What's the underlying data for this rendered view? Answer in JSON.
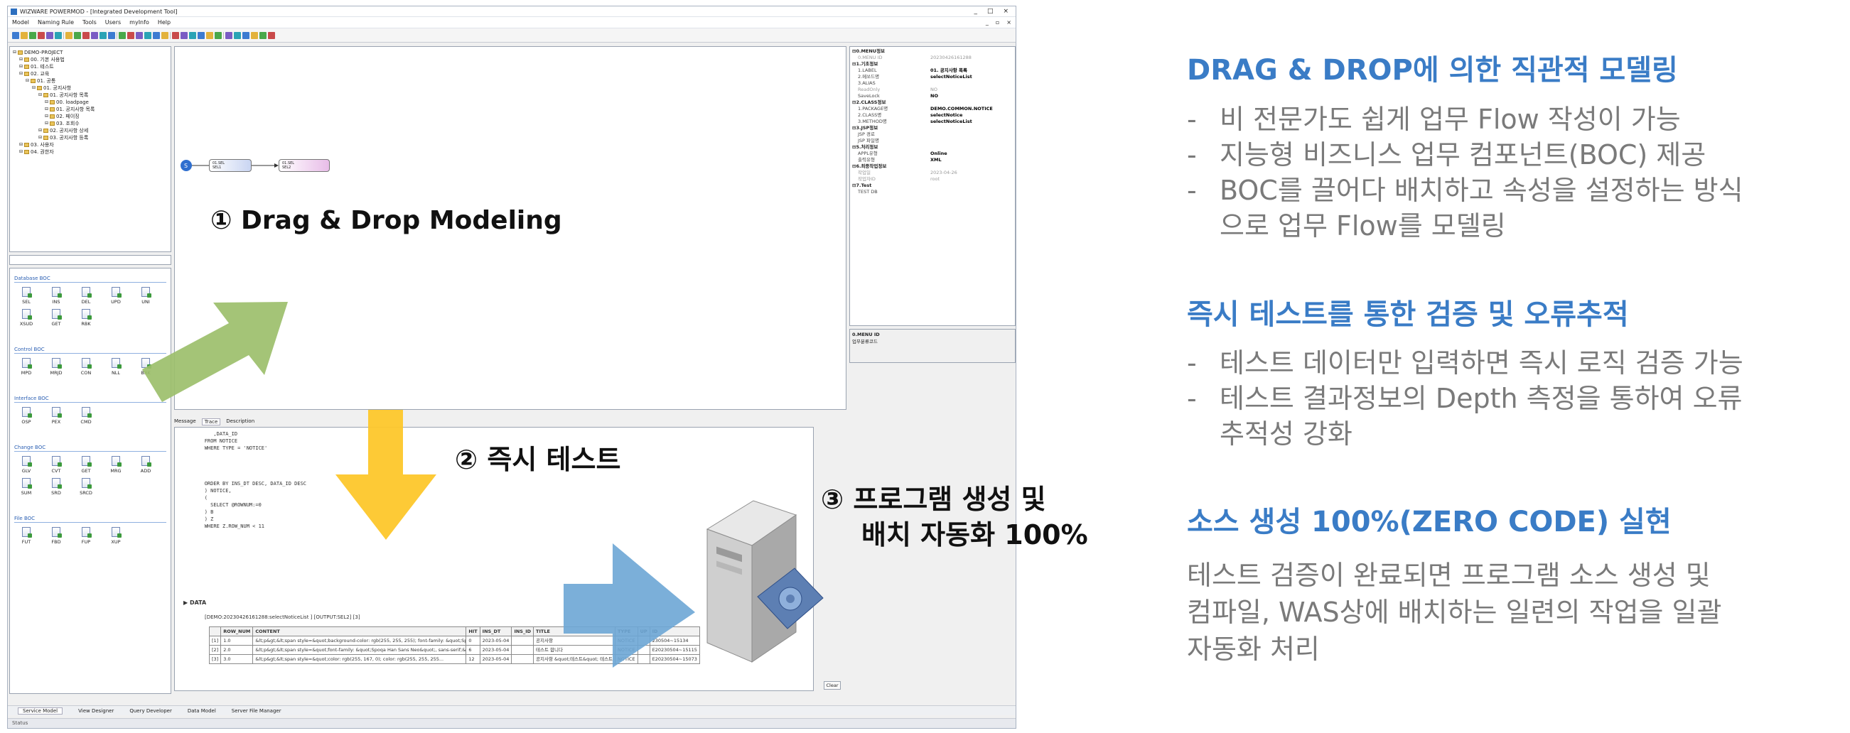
{
  "window": {
    "title": "WIZWARE POWERMOD - [Integrated Development Tool]",
    "controls": [
      "_",
      "□",
      "×"
    ]
  },
  "menu": {
    "items": [
      "Model",
      "Naming Rule",
      "Tools",
      "Users",
      "myInfo",
      "Help"
    ],
    "right": [
      "_",
      "▫",
      "×"
    ]
  },
  "tree": {
    "items": [
      {
        "label": "DEMO-PROJECT",
        "depth": 0
      },
      {
        "label": "00. 기본 사용법",
        "depth": 1
      },
      {
        "label": "01. 테스트",
        "depth": 1
      },
      {
        "label": "02. 교육",
        "depth": 1
      },
      {
        "label": "01. 공통",
        "depth": 2
      },
      {
        "label": "01. 공지사항",
        "depth": 3
      },
      {
        "label": "01. 공지사항 목록",
        "depth": 4
      },
      {
        "label": "00. loadpage",
        "depth": 5
      },
      {
        "label": "01. 공지사항 목록",
        "depth": 5
      },
      {
        "label": "02. 페이징",
        "depth": 5
      },
      {
        "label": "03. 조회수",
        "depth": 5
      },
      {
        "label": "02. 공지사항 상세",
        "depth": 4
      },
      {
        "label": "03. 공지사항 등록",
        "depth": 4
      },
      {
        "label": "03. 사용자",
        "depth": 1
      },
      {
        "label": "04. 권한자",
        "depth": 1
      }
    ]
  },
  "palette": {
    "categories": [
      {
        "name": "Database BOC",
        "items": [
          "SEL",
          "INS",
          "DEL",
          "UPD",
          "UNI",
          "XSUD",
          "GET",
          "RBK"
        ]
      },
      {
        "name": "Control BOC",
        "items": [
          "MPD",
          "MRJD",
          "CON",
          "NLL",
          "BRK"
        ]
      },
      {
        "name": "Interface BOC",
        "items": [
          "OSP",
          "PEX",
          "CMD"
        ]
      },
      {
        "name": "Change BOC",
        "items": [
          "GLV",
          "CVT",
          "GET",
          "MRG",
          "ADD",
          "SUM",
          "SRD",
          "SRCD"
        ]
      },
      {
        "name": "File BOC",
        "items": [
          "FUT",
          "FBD",
          "FUP",
          "XUP"
        ]
      }
    ]
  },
  "flow": {
    "start": "S",
    "nodes": [
      {
        "l1": "01.SEL",
        "l2": "SEL1"
      },
      {
        "l1": "01.SEL",
        "l2": "SEL2"
      }
    ]
  },
  "properties": {
    "groups": [
      {
        "title": "0.MENU정보",
        "rows": [
          [
            "0.MENU ID",
            "20230426161288",
            true
          ]
        ]
      },
      {
        "title": "1.기초정보",
        "rows": [
          [
            "1.LABEL",
            "01. 공지사항 목록",
            false
          ],
          [
            "2.메쏘드명",
            "selectNoticeList",
            false
          ],
          [
            "3.ALIAS",
            "",
            false
          ],
          [
            "ReadOnly",
            "NO",
            true
          ],
          [
            "SaveLock",
            "NO",
            false
          ]
        ]
      },
      {
        "title": "2.CLASS정보",
        "rows": [
          [
            "1.PACKAGE명",
            "DEMO.COMMON.NOTICE",
            false
          ],
          [
            "2.CLASS명",
            "selectNotice",
            false
          ],
          [
            "3.METHOD명",
            "selectNoticeList",
            false
          ]
        ]
      },
      {
        "title": "3.JSP정보",
        "rows": [
          [
            "JSP 경로",
            "",
            false
          ],
          [
            "JSP 파일명",
            "",
            false
          ]
        ]
      },
      {
        "title": "5.처리정보",
        "rows": [
          [
            "APPL유형",
            "Online",
            false
          ],
          [
            "출력유형",
            "XML",
            false
          ]
        ]
      },
      {
        "title": "6.최종작업정보",
        "rows": [
          [
            "작업일",
            "2023-04-26",
            true
          ],
          [
            "작업자ID",
            "root",
            true
          ]
        ]
      },
      {
        "title": "7.Test",
        "rows": [
          [
            "TEST DB",
            "",
            false
          ]
        ]
      }
    ],
    "desc_title": "0.MENU ID",
    "desc_text": "업무분류코드"
  },
  "bottom_tabs": [
    "Message",
    "Trace",
    "Description"
  ],
  "console": {
    "sql": "           ,DATA_ID\n        FROM NOTICE\n        WHERE TYPE = 'NOTICE'\n\n\n\n\n        ORDER BY INS_DT DESC, DATA_ID DESC\n        ) NOTICE,\n        (\n          SELECT @ROWNUM:=0\n        ) B\n        ) Z\n        WHERE Z.ROW_NUM < 11",
    "data_header": "▶ DATA",
    "data_sub": "[DEMO:20230426161288:selectNoticeList ]  [OUTPUT:SEL2]  [3]",
    "columns": [
      "",
      "ROW_NUM",
      "CONTENT",
      "HIT",
      "INS_DT",
      "INS_ID",
      "TITLE",
      "TYPE",
      "UP",
      "ID"
    ],
    "rows": [
      [
        "[1]",
        "1.0",
        "&lt;p&gt;&lt;span style=&quot;background-color: rgb(255, 255, 255); font-family: &quot;Spo...",
        "0",
        "2023-05-04",
        "",
        "공지사항",
        "NOTICE",
        "",
        "230504~15134"
      ],
      [
        "[2]",
        "2.0",
        "&lt;p&gt;&lt;span style=&quot;font-family: &quot;Spoqa Han Sans Neo&quot;, sans-serif;&quo...",
        "6",
        "2023-05-04",
        "",
        "테스트 합니다",
        "NOTICE",
        "",
        "E20230504~15115"
      ],
      [
        "[3]",
        "3.0",
        "&lt;p&gt;&lt;span style=&quot;color: rgb(255, 167, 0); color: rgb(255, 255, 255...",
        "12",
        "2023-05-04",
        "",
        "공지사항 &quot;테스트&quot; 테스트",
        "NOTICE",
        "",
        "E20230504~15073"
      ]
    ],
    "clear_label": "Clear"
  },
  "main_tabs": [
    "Service Model",
    "View Designer",
    "Query Developer",
    "Data Model",
    "Server File Manager"
  ],
  "status": "Status",
  "callouts": {
    "c1": "① Drag & Drop Modeling",
    "c2": "② 즉시 테스트",
    "c3a": "③ 프로그램 생성 및",
    "c3b": "배치 자동화 100%"
  },
  "colors": {
    "green_arrow": "#9cbf6b",
    "yellow_arrow": "#fdc72b",
    "blue_arrow": "#6da6d5",
    "accent": "#3a7cc6",
    "gray_text": "#7a7a7a"
  },
  "right": {
    "s1_title": "DRAG & DROP에 의한 직관적 모델링",
    "s1_items": [
      "비 전문가도 쉽게 업무 Flow 작성이 가능",
      "지능형 비즈니스 업무 컴포넌트(BOC) 제공",
      "BOC를 끌어다 배치하고 속성을 설정하는 방식",
      "으로 업무 Flow를 모델링"
    ],
    "s2_title": "즉시 테스트를 통한 검증 및 오류추적",
    "s2_items": [
      "테스트 데이터만 입력하면 즉시 로직 검증 가능",
      "테스트 결과정보의 Depth 측정을 통하여 오류",
      "추적성 강화"
    ],
    "s3_title": "소스  생성 100%(ZERO CODE) 실현",
    "s3_lines": [
      "테스트 검증이 완료되면 프로그램 소스 생성 및",
      "컴파일, WAS상에 배치하는 일련의 작업을 일괄",
      "자동화 처리"
    ]
  }
}
